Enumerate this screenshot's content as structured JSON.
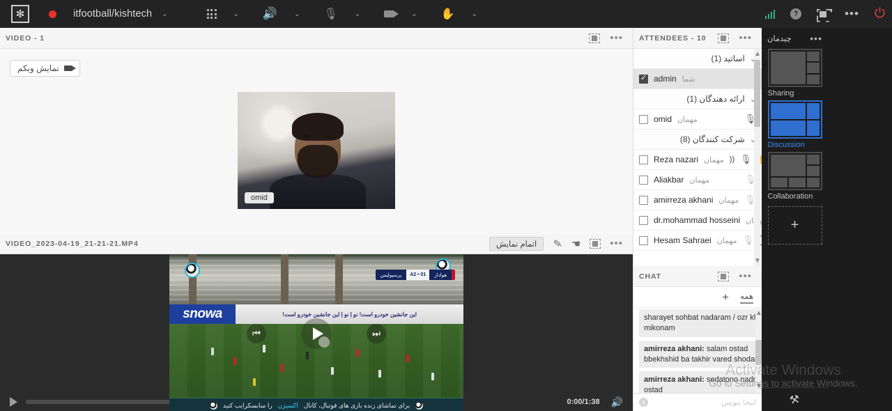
{
  "topbar": {
    "room_title": "itfootball/kishtech",
    "icons": {
      "logo": "app-logo",
      "record": "record-dot",
      "apps": "grid-apps-icon",
      "speaker": "speaker-icon",
      "mic": "microphone-icon",
      "camera": "camera-icon",
      "hand": "raise-hand-icon",
      "signal": "signal-strength-icon",
      "help": "help-icon",
      "fullscreen": "fullscreen-icon",
      "more": "more-options-icon",
      "power": "end-session-icon"
    },
    "colors": {
      "accent_green": "#2fb47c",
      "record_red": "#e8322a",
      "power_red": "#e3453c"
    }
  },
  "video_pod": {
    "title": "VIDEO  - 1",
    "webcam_button": "نمایش وبکم",
    "camera_label": "omid"
  },
  "share_pod": {
    "title": "VIDEO_2023-04-19_21-21-21.MP4",
    "end_button": "اتمام نمایش",
    "player": {
      "current_time": "0:00",
      "duration": "1:38",
      "time_display": "0:00/1:38",
      "progress_percent": 0
    },
    "video_content": {
      "board_ad": "snowa",
      "board_text": "این جانشین خودرو است! نو   |   نو   |   این جانشین خودرو است!",
      "score_home": "پرسپولیس",
      "score_value": "A2 • 01",
      "score_away": "هوادار",
      "bottom_banner": "برای تماشای زنده بازی های فوتبال، کانال",
      "bottom_banner_accent": "اکسیژن",
      "bottom_banner_end": "را سابسکرایب کنید"
    }
  },
  "attendees": {
    "title": "ATTENDEES  - 10",
    "groups": [
      {
        "label": "اساتید (1)",
        "members": [
          {
            "name": "admin",
            "role": "شما",
            "checked": true,
            "selected": true,
            "mic": false,
            "hand": false,
            "phone": false,
            "speaking": false
          }
        ]
      },
      {
        "label": "ارائه دهندگان (1)",
        "members": [
          {
            "name": "omid",
            "role": "مهمان",
            "checked": false,
            "selected": false,
            "mic": true,
            "hand": false,
            "phone": false,
            "speaking": false
          }
        ]
      },
      {
        "label": "شرکت کنندگان (8)",
        "members": [
          {
            "name": "Reza nazari",
            "role": "مهمان",
            "checked": false,
            "selected": false,
            "mic": true,
            "hand": true,
            "phone": false,
            "speaking": true
          },
          {
            "name": "Aliakbar",
            "role": "مهمان",
            "checked": false,
            "selected": false,
            "mic": true,
            "mic_dim": true,
            "hand": false,
            "phone": false,
            "speaking": false
          },
          {
            "name": "amirreza akhani",
            "role": "مهمان",
            "checked": false,
            "selected": false,
            "mic": true,
            "mic_dim": true,
            "hand": false,
            "phone": false,
            "speaking": false
          },
          {
            "name": "dr.mohammad hosseini",
            "role": "مهمان",
            "checked": false,
            "selected": false,
            "mic": true,
            "mic_dim": true,
            "hand": false,
            "phone": false,
            "speaking": false
          },
          {
            "name": "Hesam Sahraei",
            "role": "مهمان",
            "checked": false,
            "selected": false,
            "mic": true,
            "mic_dim": true,
            "hand": false,
            "phone": true,
            "speaking": false
          }
        ]
      }
    ]
  },
  "chat": {
    "title": "CHAT",
    "tab": "همه",
    "add_tab": "+",
    "input_placeholder": "اینجا بنویس",
    "messages": [
      {
        "sender": "",
        "text": "sharayet sohbat nadaram /  ozr khahi mikonam"
      },
      {
        "sender": "amirreza akhani:",
        "text": "salam ostad bbekhshid ba takhir vared shodam"
      },
      {
        "sender": "amirreza akhani:",
        "text": "sedatono nadram ostad"
      }
    ]
  },
  "layout_rail": {
    "title": "چیدمان",
    "layouts": [
      {
        "name": "Sharing",
        "active": false
      },
      {
        "name": "Discussion",
        "active": true
      },
      {
        "name": "Collaboration",
        "active": false
      }
    ],
    "add_label": "+",
    "active_color": "#2f6fd0"
  },
  "watermark": {
    "line1": "Activate Windows",
    "line2": "Go to Settings to activate Windows."
  }
}
